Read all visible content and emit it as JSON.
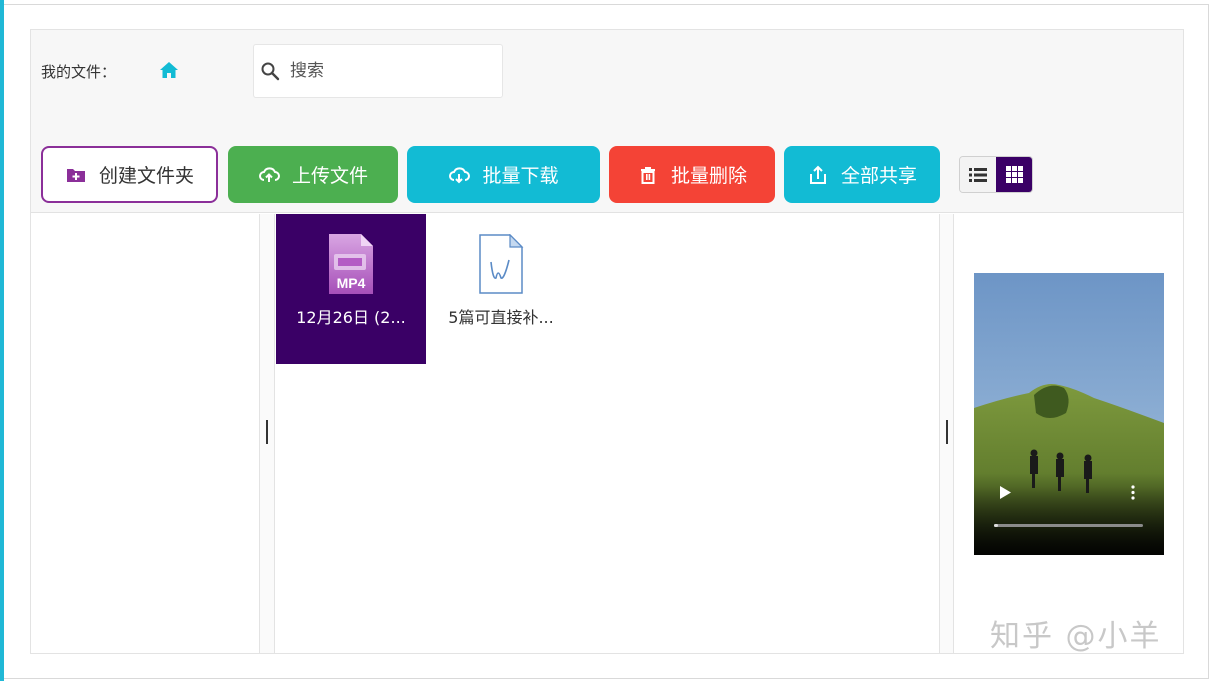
{
  "header": {
    "my_files_label": "我的文件：",
    "search": {
      "placeholder": "搜索",
      "value": ""
    }
  },
  "toolbar": {
    "create_folder": "创建文件夹",
    "upload": "上传文件",
    "batch_download": "批量下载",
    "batch_delete": "批量删除",
    "share_all": "全部共享",
    "view_mode": "grid"
  },
  "files": [
    {
      "name": "12月26日 (2...",
      "type": "MP4",
      "icon": "mp4-file-icon",
      "selected": true
    },
    {
      "name": "5篇可直接补...",
      "type": "doc",
      "icon": "word-document-icon",
      "selected": false
    }
  ],
  "preview": {
    "type": "video",
    "playing": false
  },
  "watermark": "知乎 @小羊",
  "colors": {
    "accent_cyan": "#12bbd4",
    "upload_green": "#4caf50",
    "delete_red": "#f44336",
    "create_purple": "#8b2f99",
    "selected_purple": "#3a0066"
  }
}
